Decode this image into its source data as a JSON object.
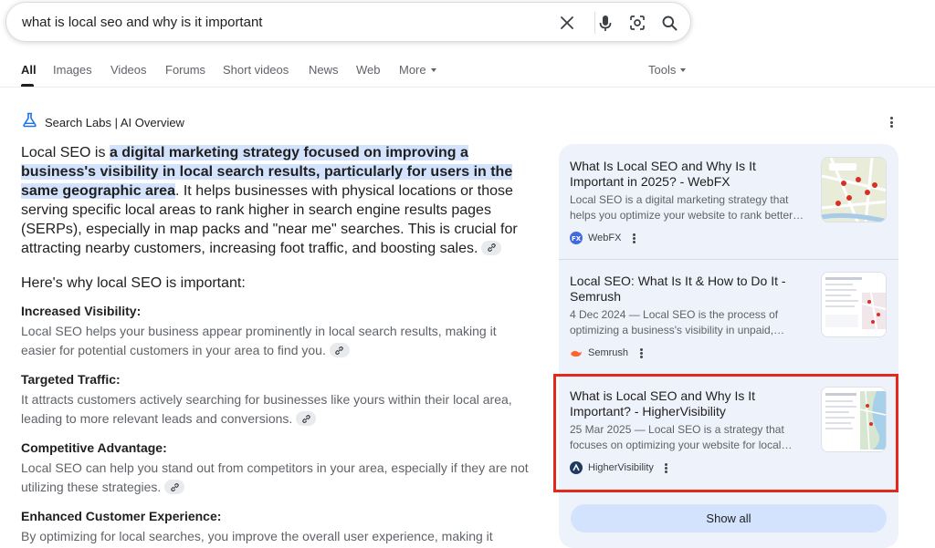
{
  "search": {
    "query": "what is local seo and why is it important"
  },
  "tabs": [
    {
      "label": "All"
    },
    {
      "label": "Images"
    },
    {
      "label": "Videos"
    },
    {
      "label": "Forums"
    },
    {
      "label": "Short videos"
    },
    {
      "label": "News"
    },
    {
      "label": "Web"
    },
    {
      "label": "More"
    }
  ],
  "tools_label": "Tools",
  "ai_overview": {
    "header": "Search Labs | AI Overview",
    "intro_lead": "Local SEO is ",
    "intro_highlight": "a digital marketing strategy focused on improving a business's visibility in local search results, particularly for users in the same geographic area",
    "intro_rest": ". It helps businesses with physical locations or those serving specific local areas to rank higher in search engine results pages (SERPs), especially in map packs and \"near me\" searches. This is crucial for attracting nearby customers, increasing foot traffic, and boosting sales.",
    "why_heading": "Here's why local SEO is important:",
    "items": [
      {
        "title": "Increased Visibility:",
        "text": "Local SEO helps your business appear prominently in local search results, making it easier for potential customers in your area to find you."
      },
      {
        "title": "Targeted Traffic:",
        "text": "It attracts customers actively searching for businesses like yours within their local area, leading to more relevant leads and conversions."
      },
      {
        "title": "Competitive Advantage:",
        "text": "Local SEO can help you stand out from competitors in your area, especially if they are not utilizing these strategies."
      },
      {
        "title": "Enhanced Customer Experience:",
        "text": "By optimizing for local searches, you improve the overall user experience, making it"
      }
    ]
  },
  "sources": [
    {
      "title": "What Is Local SEO and Why Is It Important in 2025? - WebFX",
      "snippet": "Local SEO is a digital marketing strategy that helps you optimize your website to rank better…",
      "site": "WebFX",
      "favicon_color": "#4169e1"
    },
    {
      "title": "Local SEO: What Is It & How to Do It - Semrush",
      "snippet": "4 Dec 2024 — Local SEO is the process of optimizing a business's visibility in unpaid,…",
      "site": "Semrush",
      "favicon_color": "#ff642d"
    },
    {
      "title": "What is Local SEO and Why Is It Important? - HigherVisibility",
      "snippet": "25 Mar 2025 — Local SEO is a strategy that focuses on optimizing your website for local…",
      "site": "HigherVisibility",
      "favicon_color": "#1f3a5f"
    }
  ],
  "show_all_label": "Show all",
  "colors": {
    "highlight": "#d3e3fd",
    "annotation_box": "#e3281c",
    "panel_bg": "#eef2fa"
  }
}
